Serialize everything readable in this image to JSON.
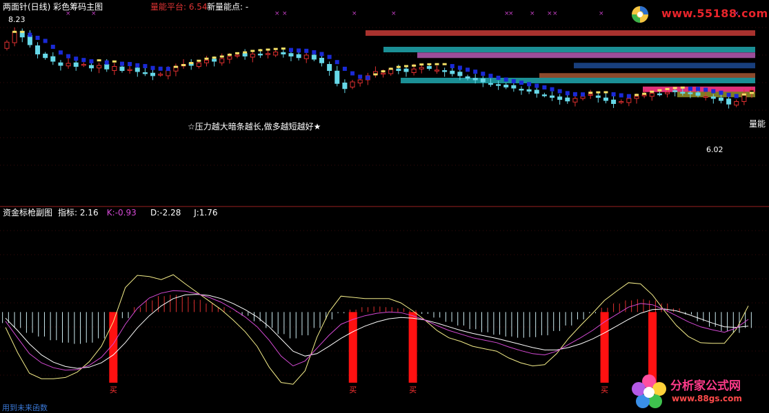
{
  "chart_data": [
    {
      "type": "candlestick",
      "panel": "main",
      "title": "两面针(日线) 彩色筹码主图",
      "indicators": [
        {
          "label": "量能平台",
          "value": "6.54"
        },
        {
          "label": "新量能点",
          "value": "-"
        }
      ],
      "labels": {
        "high_price": "8.23",
        "low_price": "6.02",
        "annotation": "☆压力越大暗条越长,做多越短越好★",
        "right_edge_label": "量能"
      },
      "price_range": [
        5.6,
        8.4
      ],
      "candle_count": 98,
      "closes": [
        7.85,
        8.05,
        7.95,
        7.8,
        7.62,
        7.55,
        7.48,
        7.4,
        7.44,
        7.38,
        7.42,
        7.35,
        7.4,
        7.33,
        7.38,
        7.3,
        7.32,
        7.28,
        7.25,
        7.2,
        7.23,
        7.3,
        7.38,
        7.42,
        7.4,
        7.45,
        7.5,
        7.48,
        7.53,
        7.57,
        7.6,
        7.58,
        7.62,
        7.6,
        7.63,
        7.66,
        7.62,
        7.58,
        7.55,
        7.6,
        7.52,
        7.45,
        7.3,
        7.05,
        6.95,
        7.08,
        7.12,
        7.2,
        7.28,
        7.25,
        7.32,
        7.3,
        7.28,
        7.33,
        7.36,
        7.34,
        7.31,
        7.28,
        7.24,
        7.2,
        7.15,
        7.12,
        7.08,
        7.04,
        7.01,
        6.98,
        6.96,
        6.93,
        6.9,
        6.86,
        6.82,
        6.78,
        6.74,
        6.71,
        6.76,
        6.8,
        6.84,
        6.78,
        6.72,
        6.66,
        6.7,
        6.76,
        6.8,
        6.83,
        6.86,
        6.84,
        6.88,
        6.9,
        6.87,
        6.85,
        6.82,
        6.8,
        6.76,
        6.72,
        6.65,
        6.7,
        6.85,
        6.92
      ],
      "volume_bars": [
        {
          "price_low": 7.98,
          "price_high": 8.08,
          "color": "#a9322e"
        },
        {
          "price_low": 7.66,
          "price_high": 7.76,
          "color": "#1b8f95"
        },
        {
          "price_low": 7.55,
          "price_high": 7.65,
          "color": "#9b4d9a"
        },
        {
          "price_low": 7.35,
          "price_high": 7.45,
          "color": "#183f7d"
        },
        {
          "price_low": 7.15,
          "price_high": 7.25,
          "color": "#8b4a2c"
        },
        {
          "price_low": 7.06,
          "price_high": 7.16,
          "color": "#1b8f95"
        },
        {
          "price_low": 6.9,
          "price_high": 6.99,
          "color": "#e2317a"
        },
        {
          "price_low": 6.8,
          "price_high": 6.89,
          "color": "#7f7d23"
        }
      ],
      "colors": {
        "up": "#e23030",
        "down": "#66d8e8",
        "ma_down": "#1a2ad6",
        "ma_up": "#f5e066",
        "title": "#ffffff",
        "indicator_label": "#e03434"
      }
    },
    {
      "type": "kdj",
      "panel": "sub",
      "title": "资金标枪副图",
      "readout": [
        {
          "label": "指标",
          "value": "2.16",
          "color": "#ffffff"
        },
        {
          "label": "K",
          "value": "-0.93",
          "color": "#d64ad6"
        },
        {
          "label": "D",
          "value": "-2.28",
          "color": "#ffffff"
        },
        {
          "label": "J",
          "value": "1.76",
          "color": "#ffffff"
        }
      ],
      "value_range": [
        -12,
        6
      ],
      "K": [
        -1.5,
        -4.2,
        -6.8,
        -8.3,
        -9.1,
        -9.5,
        -9.4,
        -8.7,
        -7.4,
        -5.2,
        -2.0,
        0.6,
        2.3,
        3.1,
        3.5,
        3.4,
        3.0,
        2.4,
        1.6,
        0.5,
        -0.8,
        -2.4,
        -4.6,
        -7.2,
        -8.8,
        -8.0,
        -5.9,
        -3.8,
        -2.0,
        -1.2,
        -0.6,
        -0.2,
        0.0,
        -0.1,
        -0.6,
        -1.3,
        -2.2,
        -3.0,
        -3.6,
        -4.2,
        -4.6,
        -5.0,
        -5.7,
        -6.3,
        -6.8,
        -7.0,
        -6.4,
        -5.3,
        -4.2,
        -3.0,
        -1.6,
        -0.4,
        0.8,
        1.4,
        1.2,
        0.4,
        -0.6,
        -1.6,
        -2.4,
        -2.9,
        -3.3,
        -2.6,
        -1.2
      ],
      "D": [
        -1.0,
        -3.0,
        -5.2,
        -7.0,
        -8.2,
        -8.9,
        -9.2,
        -9.0,
        -8.3,
        -7.0,
        -5.0,
        -2.6,
        -0.6,
        1.0,
        2.2,
        2.8,
        2.9,
        2.7,
        2.2,
        1.4,
        0.4,
        -0.8,
        -2.4,
        -4.4,
        -6.4,
        -7.2,
        -6.8,
        -5.6,
        -4.3,
        -3.2,
        -2.3,
        -1.6,
        -1.1,
        -0.9,
        -1.0,
        -1.3,
        -1.8,
        -2.4,
        -3.0,
        -3.5,
        -3.9,
        -4.3,
        -4.8,
        -5.3,
        -5.8,
        -6.2,
        -6.2,
        -5.8,
        -5.2,
        -4.4,
        -3.4,
        -2.3,
        -1.2,
        -0.2,
        0.4,
        0.5,
        0.2,
        -0.4,
        -1.1,
        -1.8,
        -2.4,
        -2.5,
        -2.3
      ],
      "J": [
        -2.5,
        -6.6,
        -10.0,
        -10.9,
        -10.9,
        -10.7,
        -9.8,
        -8.1,
        -5.6,
        -1.6,
        4.0,
        6.0,
        5.8,
        5.3,
        6.1,
        4.6,
        3.2,
        1.8,
        0.4,
        -1.3,
        -3.2,
        -5.6,
        -9.0,
        -11.5,
        -11.8,
        -9.6,
        -4.1,
        0.0,
        2.6,
        2.4,
        2.2,
        2.2,
        2.2,
        1.5,
        0.2,
        -1.3,
        -3.0,
        -4.2,
        -4.8,
        -5.6,
        -6.0,
        -6.4,
        -7.5,
        -8.3,
        -8.8,
        -8.6,
        -6.8,
        -4.3,
        -2.2,
        -0.2,
        1.9,
        3.4,
        4.8,
        4.6,
        2.8,
        0.2,
        -2.2,
        -4.0,
        -5.0,
        -5.1,
        -5.1,
        -2.8,
        1.0
      ],
      "histogram": [
        -1.8,
        -2.6,
        -3.4,
        -4.0,
        -4.6,
        -5.0,
        -5.2,
        -5.0,
        -4.3,
        -3.0,
        -1.0,
        0.8,
        1.9,
        2.6,
        2.8,
        2.5,
        2.0,
        1.4,
        0.8,
        0.2,
        -0.6,
        -1.5,
        -2.6,
        -3.6,
        -4.3,
        -3.8,
        -2.6,
        -1.2,
        -0.2,
        0.4,
        0.8,
        0.9,
        0.8,
        0.6,
        0.3,
        -0.3,
        -0.9,
        -1.6,
        -2.2,
        -2.8,
        -3.3,
        -3.7,
        -4.0,
        -4.2,
        -4.1,
        -3.8,
        -3.1,
        -2.2,
        -1.2,
        -0.2,
        0.7,
        1.4,
        1.9,
        2.1,
        1.9,
        1.4,
        0.6,
        -0.4,
        -1.5,
        -2.4,
        -3.1,
        -3.4,
        -2.6
      ],
      "buy_signals": [
        {
          "index": 9,
          "label": "买"
        },
        {
          "index": 29,
          "label": "买"
        },
        {
          "index": 34,
          "label": "买"
        },
        {
          "index": 50,
          "label": "买"
        },
        {
          "index": 54,
          "label": "买"
        },
        {
          "index": 70,
          "label": "买"
        }
      ],
      "colors": {
        "K": "#d64ad6",
        "D": "#ffffff",
        "J": "#f5ee8a",
        "hist_up": "#e23030",
        "hist_down": "#cfeef4",
        "buy": "#ff1111"
      }
    }
  ],
  "watermarks": {
    "top_site": "www.55188.com",
    "bottom_title": "分析家公式网",
    "bottom_url": "www.88gs.com"
  },
  "footer": "用到未来函数"
}
